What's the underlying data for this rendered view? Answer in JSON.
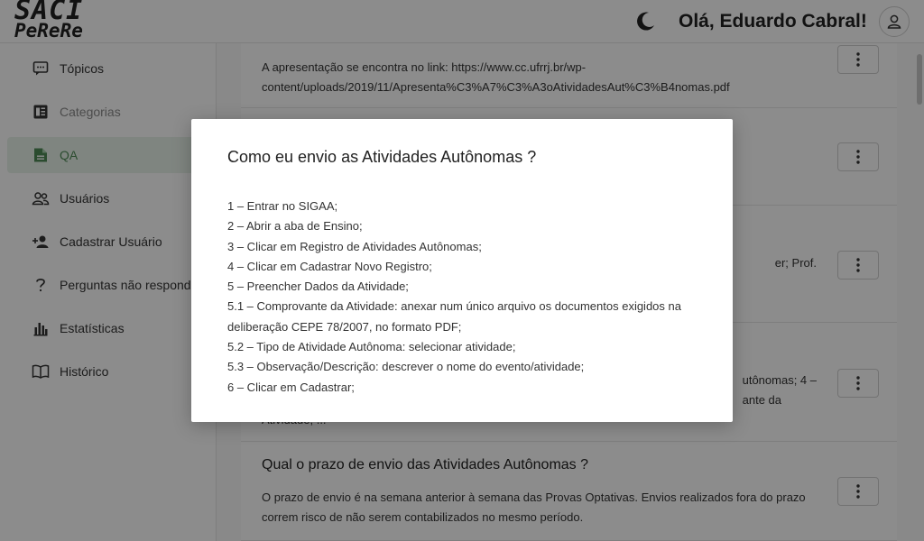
{
  "app": {
    "logo_line1": "SACI",
    "logo_line2": "PeReRe",
    "greeting": "Olá, Eduardo Cabral!"
  },
  "sidebar": {
    "items": [
      {
        "label": "Tópicos",
        "icon": "chat-icon",
        "state": "normal"
      },
      {
        "label": "Categorias",
        "icon": "article-icon",
        "state": "dim"
      },
      {
        "label": "QA",
        "icon": "file-icon",
        "state": "active"
      },
      {
        "label": "Usuários",
        "icon": "users-icon",
        "state": "normal"
      },
      {
        "label": "Cadastrar Usuário",
        "icon": "add-user-icon",
        "state": "normal"
      },
      {
        "label": "Perguntas não respondi...",
        "icon": "question-icon",
        "state": "normal"
      },
      {
        "label": "Estatísticas",
        "icon": "bar-chart-icon",
        "state": "normal"
      },
      {
        "label": "Histórico",
        "icon": "book-icon",
        "state": "normal"
      }
    ]
  },
  "content": {
    "cards": [
      {
        "title": "",
        "body": "A apresentação se encontra no link: https://www.cc.ufrrj.br/wp-content/uploads/2019/11/Apresenta%C3%A7%C3%A3oAtividadesAut%C3%B4nomas.pdf"
      },
      {
        "title": "",
        "body": ""
      },
      {
        "title": "",
        "body": "er; Prof."
      },
      {
        "title": "",
        "body_line1": "utônomas; 4 –",
        "body_line2": "ante da",
        "body_line3": "Atividade; ..."
      },
      {
        "title": "Qual o prazo de envio das Atividades Autônomas ?",
        "body": "O prazo de envio é na semana anterior à semana das Provas Optativas. Envios realizados fora do prazo correm risco de não serem contabilizados no mesmo período."
      }
    ]
  },
  "modal": {
    "title": "Como eu envio as Atividades Autônomas ?",
    "lines": [
      "1 – Entrar no SIGAA;",
      "2 – Abrir a aba de Ensino;",
      "3 – Clicar em Registro de Atividades Autônomas;",
      "4 – Clicar em Cadastrar Novo Registro;",
      "5 – Preencher Dados da Atividade;",
      "5.1 – Comprovante da Atividade: anexar num único arquivo os documentos exigidos na deliberação CEPE 78/2007, no formato PDF;",
      "5.2 – Tipo de Atividade Autônoma: selecionar atividade;",
      "5.3 – Observação/Descrição: descrever o nome do evento/atividade;",
      "6 – Clicar em Cadastrar;"
    ]
  },
  "colors": {
    "accent": "#4f8a57",
    "active_bg": "#e8f3ea",
    "overlay": "rgba(0,0,0,0.45)"
  }
}
